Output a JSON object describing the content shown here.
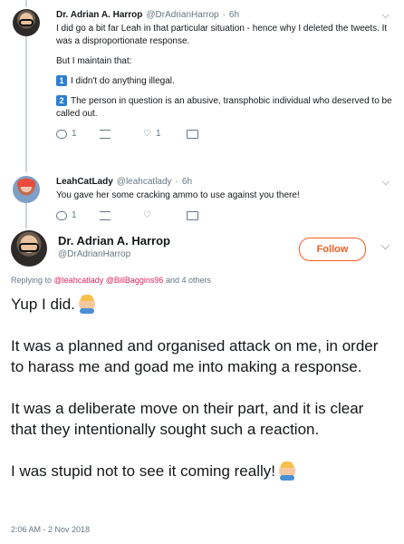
{
  "thread": [
    {
      "name": "Dr. Adrian A. Harrop",
      "handle": "@DrAdrianHarrop",
      "time": "6h",
      "paragraphs": [
        "I did go a bit far Leah in that particular situation - hence why I deleted the tweets. It was a disproportionate response.",
        "But I maintain that:"
      ],
      "points": [
        {
          "num": "1",
          "text": "I didn't do anything illegal."
        },
        {
          "num": "2",
          "text": "The person in question is an abusive, transphobic individual who deserved to be called out."
        }
      ],
      "actions": {
        "reply_count": "1",
        "retweet_count": "",
        "like_count": "1"
      }
    },
    {
      "name": "LeahCatLady",
      "handle": "@leahcatlady",
      "time": "6h",
      "text": "You gave her some cracking ammo to use against you there!",
      "actions": {
        "reply_count": "1",
        "retweet_count": "",
        "like_count": ""
      }
    }
  ],
  "main_tweet": {
    "name": "Dr. Adrian A. Harrop",
    "handle": "@DrAdrianHarrop",
    "follow_label": "Follow",
    "replying_prefix": "Replying to",
    "replying_user1": "@leahcatlady",
    "replying_user2": "@BillBaggins96",
    "replying_suffix": "and 4 others",
    "paragraphs": [
      "Yup I did.",
      "It was a planned and organised attack on me, in order to harass me and goad me into making a response.",
      "It was a deliberate move on their part, and it is clear that they intentionally sought such a reaction.",
      "I was stupid not to see it coming really!"
    ],
    "timestamp": "2:06 AM - 2 Nov 2018"
  },
  "icons": {
    "chevron": "chevron-down-icon",
    "reply": "reply-icon",
    "retweet": "retweet-icon",
    "like": "heart-icon",
    "dm": "mail-icon"
  },
  "colors": {
    "accent": "#f45d22",
    "link": "#e0245e",
    "muted": "#657786",
    "thread_line": "#ccd6dd",
    "number_badge": "#2d7fd0"
  }
}
